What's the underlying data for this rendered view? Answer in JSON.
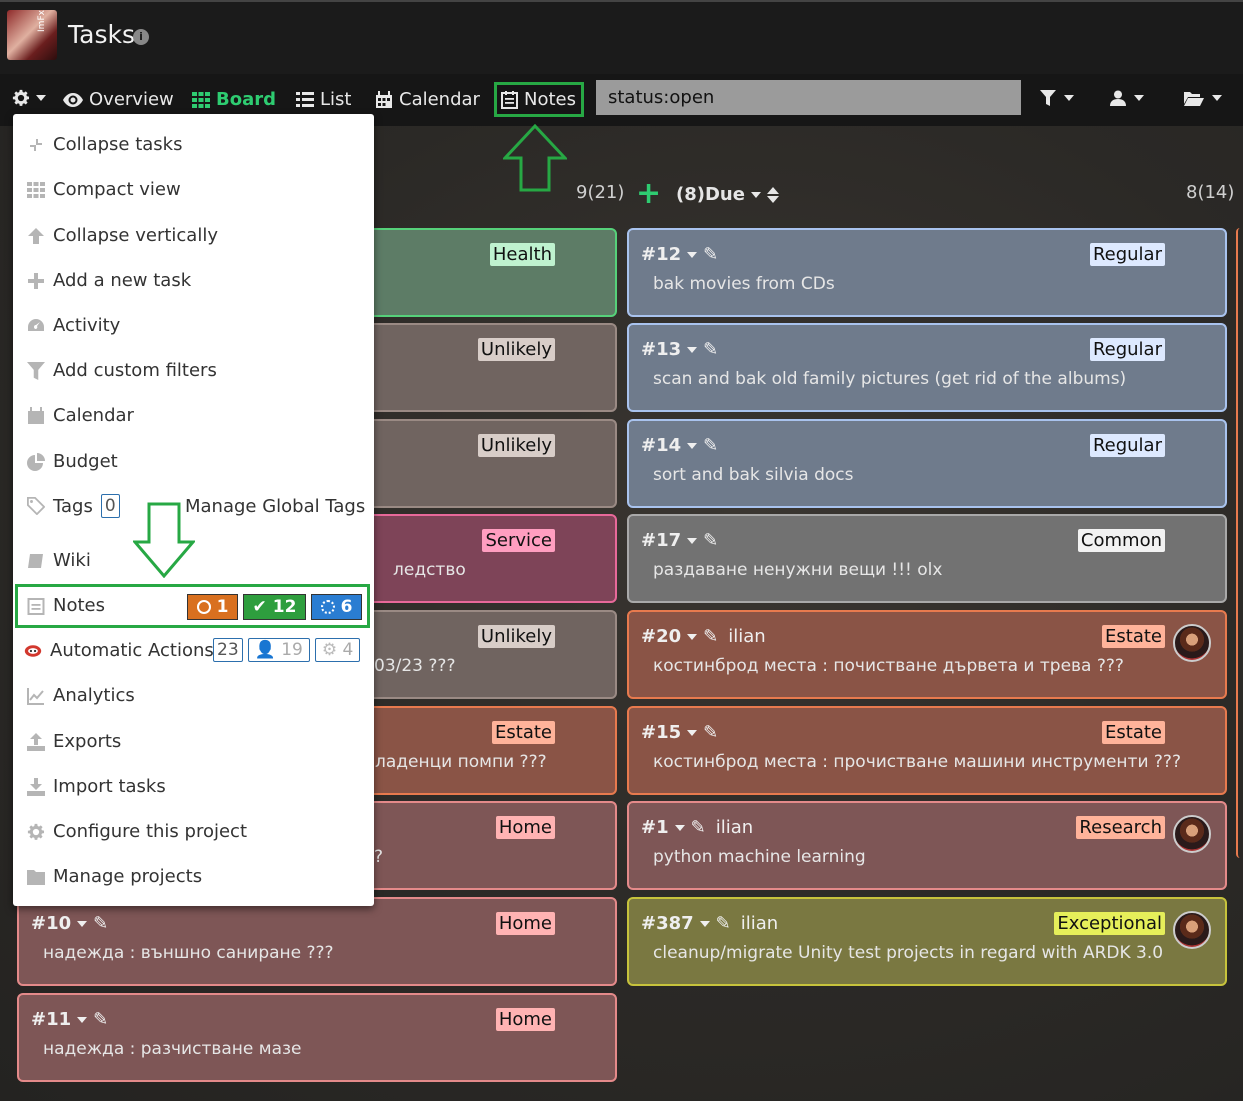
{
  "header": {
    "title": "Tasks",
    "logo_text": "ImFx"
  },
  "nav": {
    "overview": "Overview",
    "board": "Board",
    "list": "List",
    "calendar": "Calendar",
    "notes": "Notes",
    "search_value": "status:open"
  },
  "columns": {
    "left_count": "9(21)",
    "due_title": "(8)Due",
    "due_count": "8(14)"
  },
  "menu": {
    "items": [
      {
        "label": "Collapse tasks",
        "icon": "collapse-icon"
      },
      {
        "label": "Compact view",
        "icon": "grid-icon"
      },
      {
        "label": "Collapse vertically",
        "icon": "arrow-up-icon"
      },
      {
        "label": "Add a new task",
        "icon": "plus-icon"
      },
      {
        "label": "Activity",
        "icon": "dashboard-icon"
      },
      {
        "label": "Add custom filters",
        "icon": "filter-icon"
      },
      {
        "label": "Calendar",
        "icon": "calendar-icon"
      },
      {
        "label": "Budget",
        "icon": "pie-icon"
      },
      {
        "label": "Tags",
        "icon": "tags-icon"
      },
      {
        "label": "Wiki",
        "icon": "book-icon"
      },
      {
        "label": "Notes",
        "icon": "notes-icon"
      },
      {
        "label": "Automatic Actions",
        "icon": "robot-icon"
      },
      {
        "label": "Analytics",
        "icon": "line-chart-icon"
      },
      {
        "label": "Exports",
        "icon": "upload-icon"
      },
      {
        "label": "Import tasks",
        "icon": "download-icon"
      },
      {
        "label": "Configure this project",
        "icon": "gear-icon"
      },
      {
        "label": "Manage projects",
        "icon": "folder-icon"
      }
    ],
    "tags_count": "0",
    "manage_global_tags": "Manage Global Tags",
    "notes_badges": {
      "open": "1",
      "done": "12",
      "progress": "6"
    },
    "actions_counts": {
      "total": "23",
      "user": "19",
      "system": "4"
    }
  },
  "left_cards": [
    {
      "tag": "Health",
      "text": ""
    },
    {
      "tag": "Unlikely",
      "text": ""
    },
    {
      "tag": "Unlikely",
      "text": ""
    },
    {
      "tag": "Service",
      "text": "ледство"
    },
    {
      "tag": "Unlikely",
      "text": "03/23 ???"
    },
    {
      "tag": "Estate",
      "text": "ладенци помпи ???"
    },
    {
      "tag": "Home",
      "text": "?"
    },
    {
      "id": "#10",
      "tag": "Home",
      "text": "надежда : външно саниране ???"
    },
    {
      "id": "#11",
      "tag": "Home",
      "text": "надежда : разчистване мазе"
    }
  ],
  "due_cards": [
    {
      "id": "#12",
      "owner": "",
      "tag": "Regular",
      "text": "bak movies from CDs"
    },
    {
      "id": "#13",
      "owner": "",
      "tag": "Regular",
      "text": "scan and bak old family pictures (get rid of the albums)"
    },
    {
      "id": "#14",
      "owner": "",
      "tag": "Regular",
      "text": "sort and bak silvia docs"
    },
    {
      "id": "#17",
      "owner": "",
      "tag": "Common",
      "text": "раздаване ненужни вещи !!! olx"
    },
    {
      "id": "#20",
      "owner": "ilian",
      "tag": "Estate",
      "text": "костинброд места : почистване дървета и трева ???"
    },
    {
      "id": "#15",
      "owner": "",
      "tag": "Estate",
      "text": "костинброд места : прочистване машини инструменти ???"
    },
    {
      "id": "#1",
      "owner": "ilian",
      "tag": "Research",
      "text": "python machine learning"
    },
    {
      "id": "#387",
      "owner": "ilian",
      "tag": "Exceptional",
      "text": "cleanup/migrate Unity test projects in regard with ARDK 3.0"
    }
  ],
  "colors": {
    "accent_green": "#2ecc71",
    "highlight_green": "#27a844"
  }
}
